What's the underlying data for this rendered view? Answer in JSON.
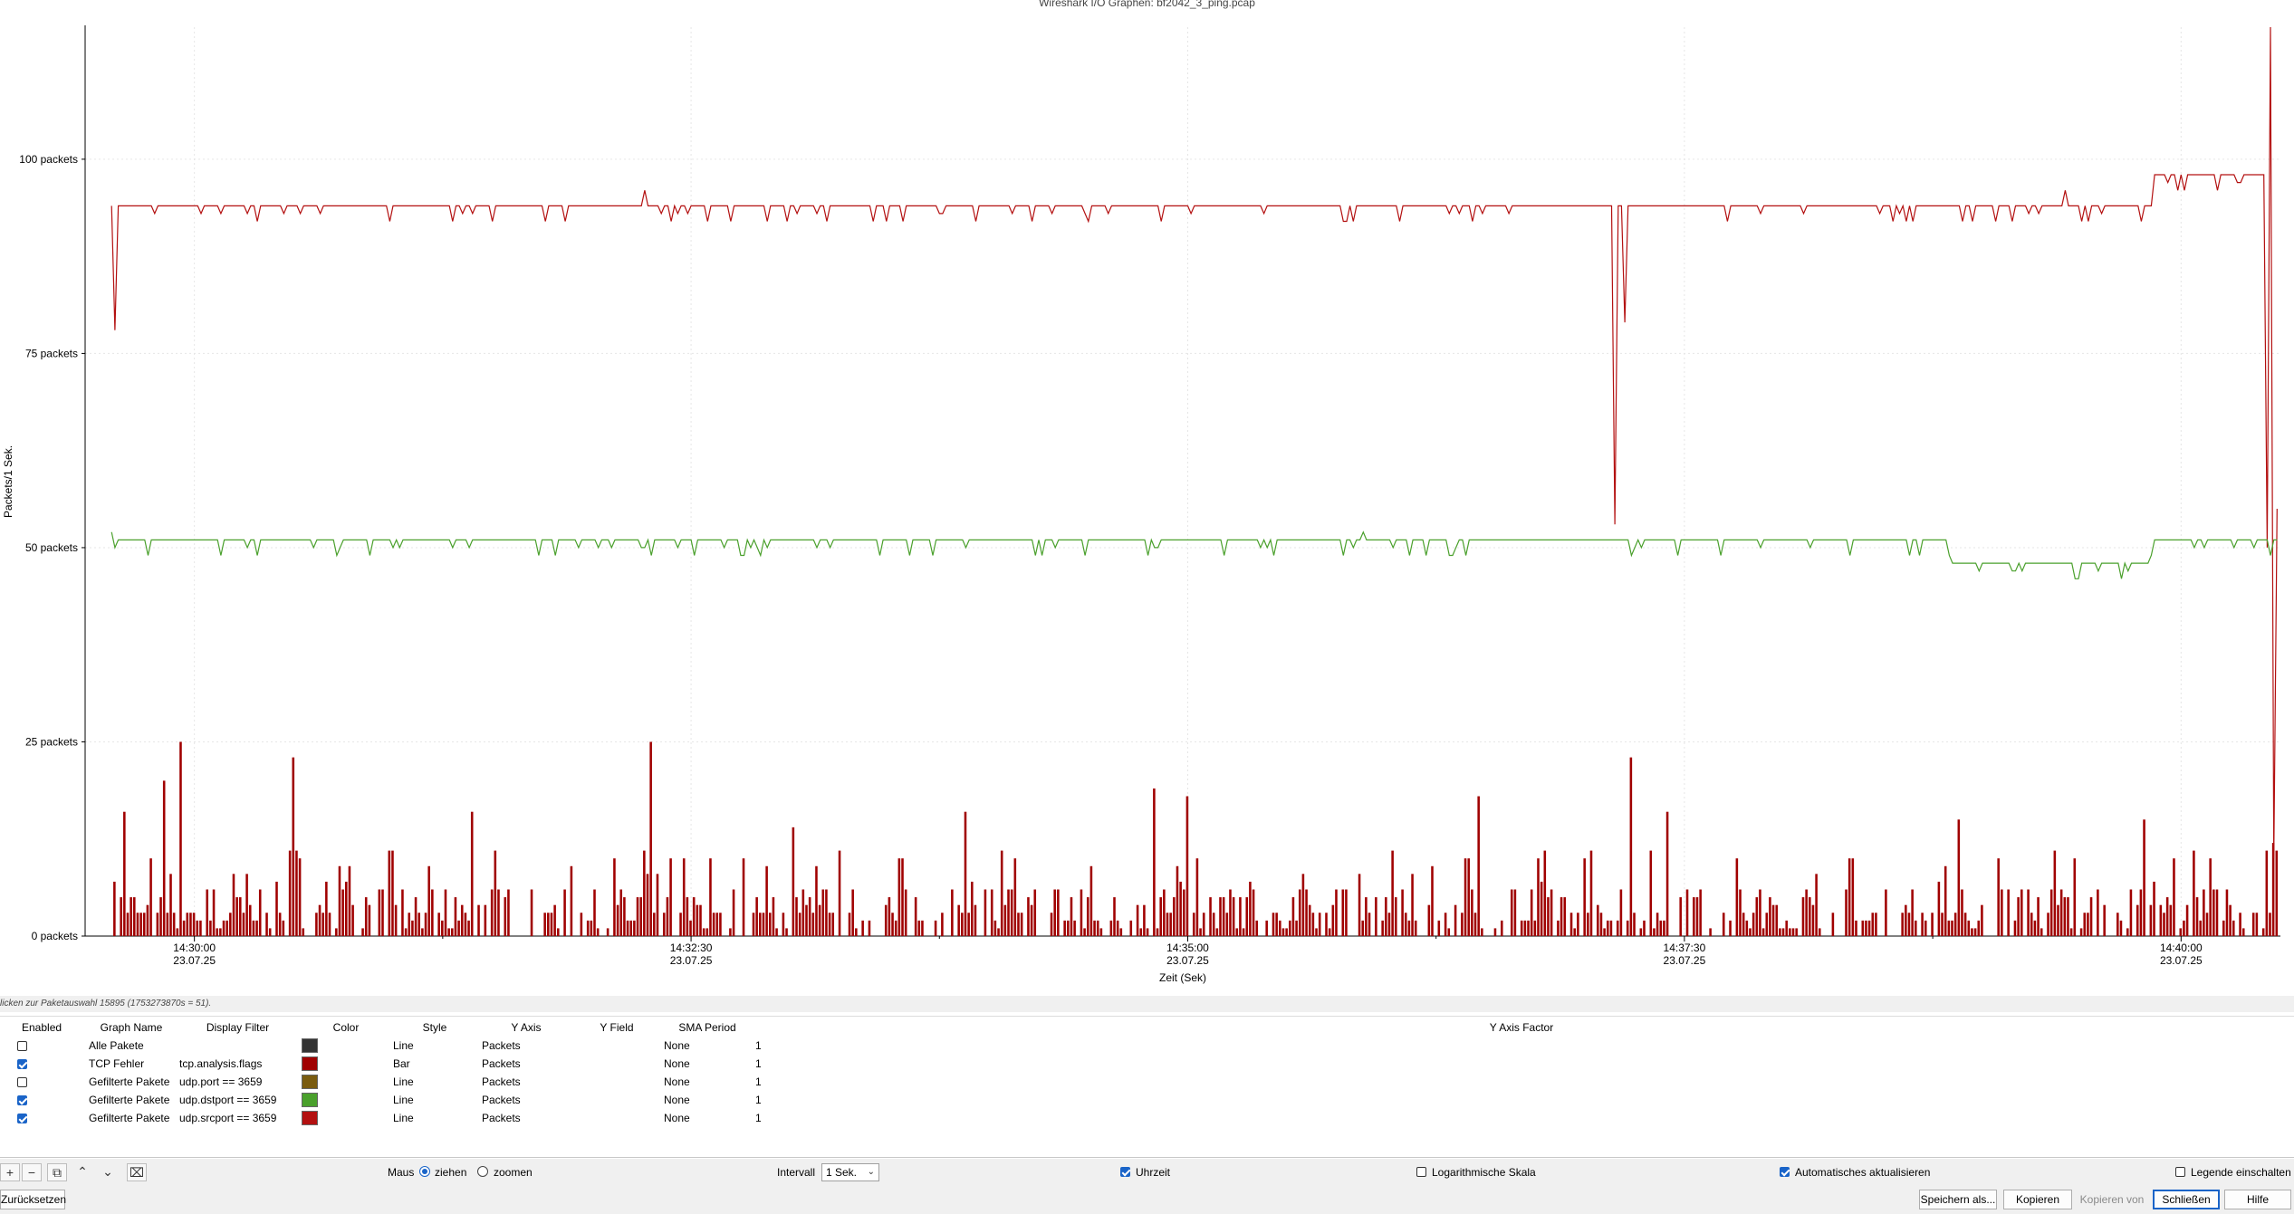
{
  "window": {
    "title": "Wireshark I/O Graphen: bf2042_3_ping.pcap"
  },
  "chart_data": {
    "type": "line",
    "ylabel": "Packets/1 Sek.",
    "xlabel": "Zeit (Sek)",
    "ylim": [
      0,
      117
    ],
    "yticks": [
      {
        "value": 0,
        "label": "0 packets"
      },
      {
        "value": 25,
        "label": "25 packets"
      },
      {
        "value": 50,
        "label": "50 packets"
      },
      {
        "value": 75,
        "label": "75 packets"
      },
      {
        "value": 100,
        "label": "100 packets"
      }
    ],
    "xlim": [
      "14:29:27",
      "14:40:30"
    ],
    "xticks": [
      {
        "time": "14:30:00",
        "date": "23.07.25"
      },
      {
        "time": "14:32:30",
        "date": "23.07.25"
      },
      {
        "time": "14:35:00",
        "date": "23.07.25"
      },
      {
        "time": "14:37:30",
        "date": "23.07.25"
      },
      {
        "time": "14:40:00",
        "date": "23.07.25"
      }
    ],
    "grid": true,
    "series": [
      {
        "name": "udp.srcport == 3659",
        "style": "line",
        "color": "#b31010",
        "baseline": 94,
        "points": [
          [
            "14:29:35",
            94
          ],
          [
            "14:29:36",
            78
          ],
          [
            "14:29:37",
            94
          ],
          [
            "14:32:16",
            96
          ],
          [
            "14:37:09",
            53
          ],
          [
            "14:37:10",
            94
          ],
          [
            "14:37:12",
            79
          ],
          [
            "14:37:14",
            94
          ],
          [
            "14:39:25",
            96
          ],
          [
            "14:39:51",
            94
          ],
          [
            "14:39:52",
            98
          ],
          [
            "14:40:25",
            98
          ],
          [
            "14:40:26",
            50
          ],
          [
            "14:40:27",
            117
          ],
          [
            "14:40:28",
            10
          ],
          [
            "14:40:29",
            55
          ]
        ]
      },
      {
        "name": "udp.dstport == 3659",
        "style": "line",
        "color": "#4aa02c",
        "baseline": 51,
        "points": [
          [
            "14:29:35",
            52
          ],
          [
            "14:29:36",
            50
          ],
          [
            "14:30:43",
            49
          ],
          [
            "14:33:27",
            49
          ],
          [
            "14:35:26",
            49
          ],
          [
            "14:35:53",
            52
          ],
          [
            "14:38:50",
            49
          ],
          [
            "14:39:00",
            48
          ],
          [
            "14:39:10",
            47
          ],
          [
            "14:39:20",
            48
          ],
          [
            "14:39:51",
            49
          ],
          [
            "14:39:53",
            51
          ],
          [
            "14:40:29",
            51
          ]
        ]
      },
      {
        "name": "tcp.analysis.flags",
        "style": "bar",
        "color": "#a00000",
        "peaks": [
          [
            "14:29:39",
            16
          ],
          [
            "14:29:51",
            20
          ],
          [
            "14:29:56",
            25
          ],
          [
            "14:30:30",
            23
          ],
          [
            "14:31:24",
            16
          ],
          [
            "14:32:18",
            25
          ],
          [
            "14:33:01",
            14
          ],
          [
            "14:33:53",
            16
          ],
          [
            "14:34:50",
            19
          ],
          [
            "14:35:00",
            18
          ],
          [
            "14:36:28",
            18
          ],
          [
            "14:37:14",
            23
          ],
          [
            "14:37:25",
            16
          ],
          [
            "14:38:53",
            15
          ],
          [
            "14:39:49",
            15
          ],
          [
            "14:40:28",
            12
          ]
        ]
      }
    ]
  },
  "hint": "licken zur Paketauswahl 15895 (1753273870s = 51).",
  "table": {
    "headers": [
      "Enabled",
      "Graph Name",
      "Display Filter",
      "Color",
      "Style",
      "Y Axis",
      "Y Field",
      "SMA Period",
      "Y Axis Factor"
    ],
    "rows": [
      {
        "enabled": false,
        "name": "Alle Pakete",
        "filter": "",
        "color": "#333333",
        "style": "Line",
        "yaxis": "Packets",
        "yfield": "",
        "sma": "None",
        "factor": "1"
      },
      {
        "enabled": true,
        "name": "TCP Fehler",
        "filter": "tcp.analysis.flags",
        "color": "#a00000",
        "style": "Bar",
        "yaxis": "Packets",
        "yfield": "",
        "sma": "None",
        "factor": "1"
      },
      {
        "enabled": false,
        "name": "Gefilterte Pakete",
        "filter": "udp.port == 3659",
        "color": "#7a5c10",
        "style": "Line",
        "yaxis": "Packets",
        "yfield": "",
        "sma": "None",
        "factor": "1"
      },
      {
        "enabled": true,
        "name": "Gefilterte Pakete",
        "filter": "udp.dstport == 3659",
        "color": "#4aa02c",
        "style": "Line",
        "yaxis": "Packets",
        "yfield": "",
        "sma": "None",
        "factor": "1"
      },
      {
        "enabled": true,
        "name": "Gefilterte Pakete",
        "filter": "udp.srcport == 3659",
        "color": "#b31010",
        "style": "Line",
        "yaxis": "Packets",
        "yfield": "",
        "sma": "None",
        "factor": "1"
      }
    ]
  },
  "toolbar": {
    "mouse_label": "Maus",
    "drag_label": "ziehen",
    "zoom_label": "zoomen",
    "mouse_mode": "ziehen",
    "interval_label": "Intervall",
    "interval_value": "1 Sek.",
    "clock_label": "Uhrzeit",
    "clock_checked": true,
    "log_label": "Logarithmische Skala",
    "log_checked": false,
    "auto_label": "Automatisches aktualisieren",
    "auto_checked": true,
    "legend_label": "Legende einschalten",
    "legend_checked": false,
    "icons": [
      "add-icon",
      "remove-icon",
      "copy-icon",
      "move-up-icon",
      "move-down-icon",
      "clear-icon"
    ]
  },
  "buttons": {
    "reset": "Zurücksetzen",
    "save": "Speichern als...",
    "copy": "Kopieren",
    "copy_from": "Kopieren von",
    "close": "Schließen",
    "help": "Hilfe"
  }
}
